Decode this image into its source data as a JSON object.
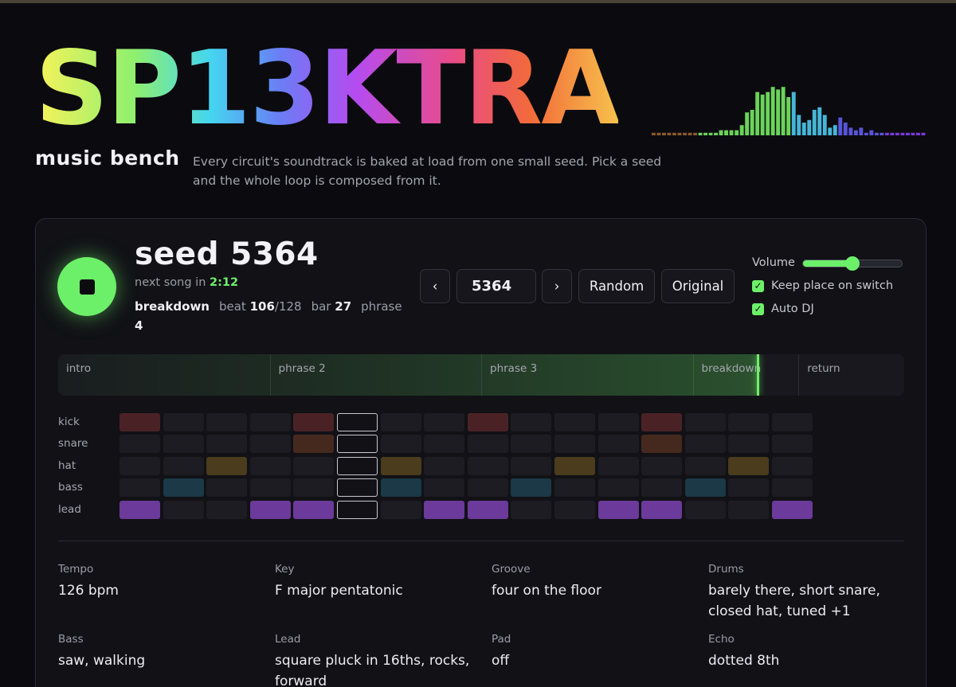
{
  "header": {
    "logo_text": "SP13KTRA",
    "subtitle": "music bench",
    "tagline": "Every circuit's soundtrack is baked at load from one small seed. Pick a seed and the whole loop is composed from it."
  },
  "spectrum": {
    "levels": [
      0.05,
      0.05,
      0.05,
      0.05,
      0.05,
      0.05,
      0.05,
      0.05,
      0.05,
      0.05,
      0.05,
      0.05,
      0.05,
      0.1,
      0.1,
      0.1,
      0.1,
      0.2,
      0.45,
      0.5,
      0.85,
      0.8,
      0.85,
      0.95,
      0.9,
      0.95,
      0.75,
      0.85,
      0.4,
      0.25,
      0.3,
      0.5,
      0.55,
      0.4,
      0.15,
      0.2,
      0.35,
      0.25,
      0.15,
      0.1,
      0.15,
      0.05,
      0.1,
      0.05,
      0.05,
      0.05,
      0.05,
      0.05,
      0.05,
      0.05,
      0.05,
      0.05,
      0.05
    ],
    "colors": [
      "#8a5a2a",
      "#6bd35a",
      "#6bd35a",
      "#46b6d8",
      "#5a55d8",
      "#7a3ad8"
    ]
  },
  "player": {
    "state_icon": "stop-icon",
    "seed_title": "seed 5364",
    "next_song_label": "next song in",
    "next_song_time": "2:12",
    "section_name": "breakdown",
    "beat_label": "beat",
    "beat_current": "106",
    "beat_total": "/128",
    "bar_label": "bar",
    "bar_value": "27",
    "phrase_label": "phrase",
    "phrase_value": "4",
    "progress": 0.827
  },
  "controls": {
    "prev_label": "‹",
    "seed_value": "5364",
    "next_label": "›",
    "random_label": "Random",
    "original_label": "Original",
    "volume_label": "Volume",
    "volume_level": 0.5,
    "keep_place_label": "Keep place on switch",
    "keep_place_checked": true,
    "auto_dj_label": "Auto DJ",
    "auto_dj_checked": true,
    "accent_color": "#6df069"
  },
  "timeline": {
    "sections": [
      {
        "label": "intro",
        "beats": 32
      },
      {
        "label": "phrase 2",
        "beats": 32
      },
      {
        "label": "phrase 3",
        "beats": 32
      },
      {
        "label": "breakdown",
        "beats": 16
      },
      {
        "label": "return",
        "beats": 16
      }
    ]
  },
  "sequencer": {
    "steps": 16,
    "current_step": 5,
    "tracks": [
      {
        "name": "kick",
        "color": "#4a2226",
        "pattern": [
          1,
          0,
          0,
          0,
          1,
          0,
          0,
          0,
          1,
          0,
          0,
          0,
          1,
          0,
          0,
          0
        ]
      },
      {
        "name": "snare",
        "color": "#46291e",
        "pattern": [
          0,
          0,
          0,
          0,
          1,
          0,
          0,
          0,
          0,
          0,
          0,
          0,
          1,
          0,
          0,
          0
        ]
      },
      {
        "name": "hat",
        "color": "#4a3c1c",
        "pattern": [
          0,
          0,
          1,
          0,
          0,
          0,
          1,
          0,
          0,
          0,
          1,
          0,
          0,
          0,
          1,
          0
        ]
      },
      {
        "name": "bass",
        "color": "#1b3946",
        "pattern": [
          0,
          1,
          0,
          0,
          0,
          0,
          1,
          0,
          0,
          1,
          0,
          0,
          0,
          1,
          0,
          0
        ]
      },
      {
        "name": "lead",
        "color": "#6b3a9a",
        "pattern": [
          1,
          0,
          0,
          1,
          1,
          0,
          0,
          1,
          1,
          0,
          0,
          1,
          1,
          0,
          0,
          1
        ]
      }
    ]
  },
  "details": [
    {
      "label": "Tempo",
      "value": "126 bpm"
    },
    {
      "label": "Key",
      "value": "F major pentatonic"
    },
    {
      "label": "Groove",
      "value": "four on the floor"
    },
    {
      "label": "Drums",
      "value": "barely there, short snare, closed hat, tuned +1"
    },
    {
      "label": "Bass",
      "value": "saw, walking"
    },
    {
      "label": "Lead",
      "value": "square pluck in 16ths, rocks, forward"
    },
    {
      "label": "Pad",
      "value": "off"
    },
    {
      "label": "Echo",
      "value": "dotted 8th"
    }
  ]
}
